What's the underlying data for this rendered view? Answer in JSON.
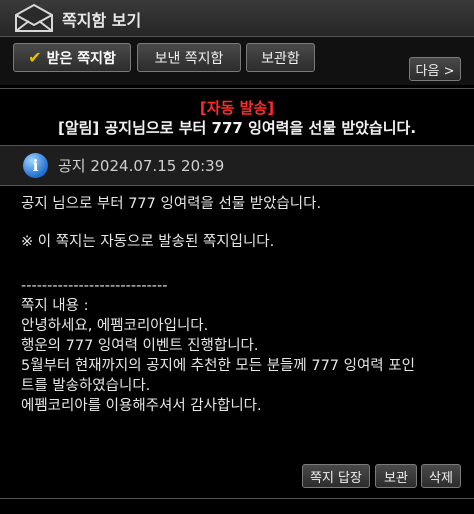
{
  "window": {
    "title": "쪽지함 보기"
  },
  "tabs": [
    {
      "label": "받은 쪽지함",
      "active": true
    },
    {
      "label": "보낸 쪽지함",
      "active": false
    },
    {
      "label": "보관함",
      "active": false
    }
  ],
  "nav": {
    "next_label": "다음 >"
  },
  "message": {
    "auto_notice": "[자동 발송]",
    "subject": "[알림] 공지님으로 부터 777 잉여력을 선물 받았습니다.",
    "sender": "공지",
    "date": "2024.07.15 20:39",
    "body": {
      "line1": "공지 님으로 부터 777 잉여력을 선물 받았습니다.",
      "line2": "※ 이 쪽지는 자동으로 발송된 쪽지입니다.",
      "separator": "----------------------------",
      "content_label": "쪽지 내용 :",
      "content_lines": [
        "안녕하세요, 에펨코리아입니다.",
        "행운의 777 잉여력 이벤트 진행합니다.",
        "5월부터 현재까지의 공지에 추천한 모든 분들께 777 잉여력 포인",
        "트를 발송하였습니다.",
        "에펨코리아를 이용해주셔서 감사합니다."
      ]
    }
  },
  "actions": {
    "reply_label": "쪽지 답장",
    "archive_label": "보관",
    "delete_label": "삭제"
  },
  "colors": {
    "background": "#000000",
    "notice_red": "#ff2b2b",
    "check_yellow": "#e8c200",
    "info_blue": "#1f6fd1"
  },
  "icons": [
    "envelope-icon",
    "check-icon",
    "info-icon"
  ]
}
